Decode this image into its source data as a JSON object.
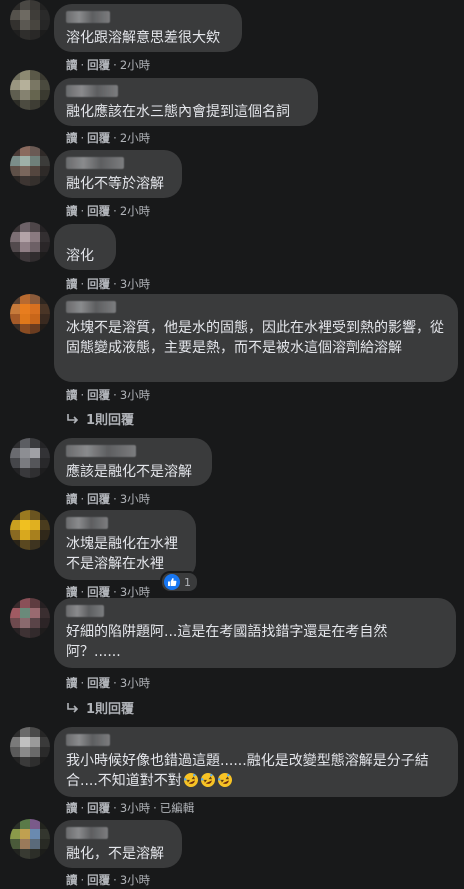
{
  "labels": {
    "read": "讀",
    "reply": "回覆",
    "dot": "·"
  },
  "comments": [
    {
      "text": "溶化跟溶解意思差很大欸",
      "time": "2小時"
    },
    {
      "text": "融化應該在水三態內會提到這個名詞",
      "time": "2小時"
    },
    {
      "text": "融化不等於溶解",
      "time": "2小時"
    },
    {
      "text": "溶化",
      "time": "3小時"
    },
    {
      "text": "冰塊不是溶質，他是水的固態，因此在水裡受到熱的影響，從固態變成液態，主要是熱，而不是被水這個溶劑給溶解",
      "time": "3小時",
      "replies_label": "1則回覆"
    },
    {
      "text": "應該是融化不是溶解",
      "time": "3小時"
    },
    {
      "text": "冰塊是融化在水裡\n不是溶解在水裡",
      "time": "3小時",
      "reaction_count": "1"
    },
    {
      "text": "好細的陷阱題阿...這是在考國語找錯字還是在考自然阿？......",
      "time": "3小時",
      "replies_label": "1則回覆"
    },
    {
      "text": "我小時候好像也錯過這題......融化是改變型態溶解是分子結合....不知道對不對",
      "emoji_count": 3,
      "time": "3小時",
      "edited": "已編輯"
    },
    {
      "text": "融化，不是溶解",
      "time": "3小時"
    }
  ],
  "colors": {
    "background": "#18191a",
    "bubble": "#3a3b3c",
    "text": "#e4e6eb",
    "secondary": "#b0b3b8",
    "like": "#1877f2"
  }
}
